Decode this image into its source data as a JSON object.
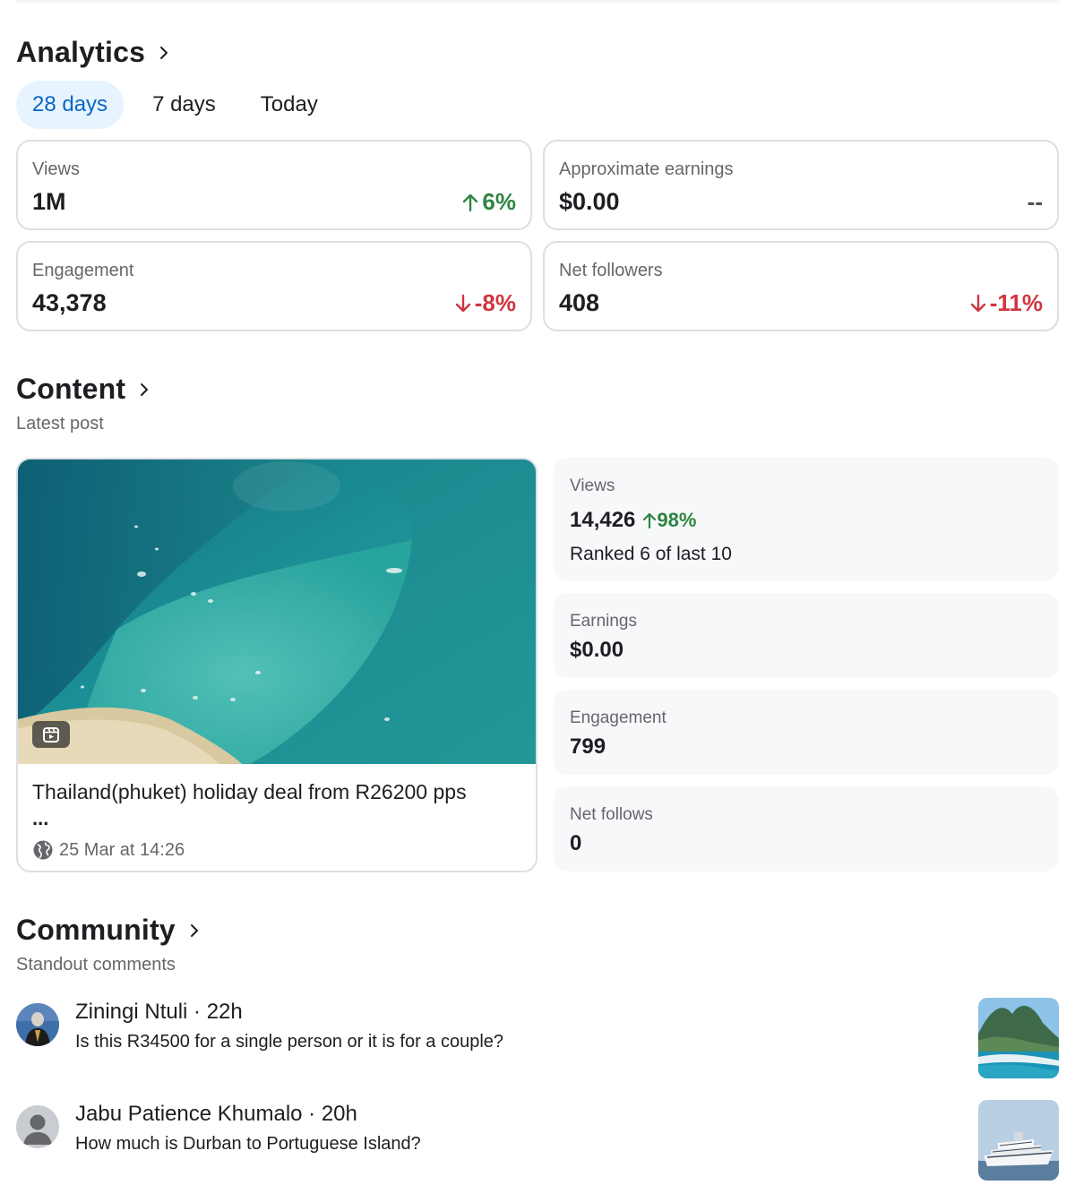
{
  "analytics": {
    "title": "Analytics",
    "tabs": [
      {
        "label": "28 days",
        "active": true
      },
      {
        "label": "7 days",
        "active": false
      },
      {
        "label": "Today",
        "active": false
      }
    ],
    "cards": [
      {
        "label": "Views",
        "value": "1M",
        "delta": "6%",
        "trend": "up"
      },
      {
        "label": "Approximate earnings",
        "value": "$0.00",
        "delta": "--",
        "trend": "none"
      },
      {
        "label": "Engagement",
        "value": "43,378",
        "delta": "-8%",
        "trend": "down"
      },
      {
        "label": "Net followers",
        "value": "408",
        "delta": "-11%",
        "trend": "down"
      }
    ]
  },
  "content": {
    "title": "Content",
    "subtitle": "Latest post",
    "post": {
      "title": "Thailand(phuket) holiday deal from R26200 pps",
      "ellipsis": "...",
      "timestamp": "25 Mar at 14:26",
      "badge_icon": "reels-icon",
      "privacy_icon": "globe-icon"
    },
    "stats": {
      "views": {
        "label": "Views",
        "value": "14,426",
        "delta": "98%",
        "rank": "Ranked 6 of last 10"
      },
      "earnings": {
        "label": "Earnings",
        "value": "$0.00"
      },
      "engagement": {
        "label": "Engagement",
        "value": "799"
      },
      "net_follows": {
        "label": "Net follows",
        "value": "0"
      }
    }
  },
  "community": {
    "title": "Community",
    "subtitle": "Standout comments",
    "comments": [
      {
        "author": "Ziningi Ntuli · 22h",
        "text": "Is this R34500 for a single person or it is for a couple?"
      },
      {
        "author": "Jabu Patience Khumalo · 20h",
        "text": "How much is Durban to Portuguese Island?"
      }
    ]
  },
  "colors": {
    "accent": "#0a66c2",
    "accent_bg": "#e7f3ff",
    "positive": "#2e8540",
    "negative": "#d0353f",
    "muted": "#65676b"
  }
}
